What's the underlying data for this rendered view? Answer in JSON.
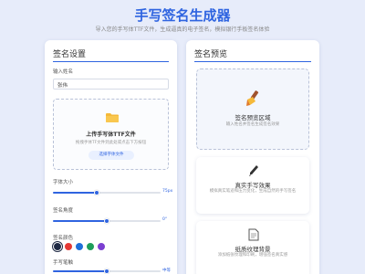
{
  "header": {
    "title": "手写签名生成器",
    "subtitle": "导入您的手写体TTF文件，生成逼真的电子签名，模拟银行手板签名体验"
  },
  "settings": {
    "title": "签名设置",
    "name_label": "输入姓名",
    "name_value": "张伟",
    "upload": {
      "title": "上传手写体TTF文件",
      "hint": "拖拽手体TF文件到此处或点击下方按钮",
      "button": "选择字体文件"
    },
    "font_size": {
      "label": "字体大小",
      "value_text": "75px",
      "fraction": 0.41
    },
    "signature_angle": {
      "label": "签名角度",
      "value_text": "0°",
      "fraction": 0.5
    },
    "signature_color": {
      "label": "签名颜色",
      "colors": [
        "#1f2a44",
        "#e53935",
        "#1e6fd9",
        "#1e9e5a",
        "#7b3fd1"
      ],
      "selected_index": 0
    },
    "stroke_thickness": {
      "label": "手写笔触",
      "value_text": "中等",
      "fraction": 0.5
    }
  },
  "preview": {
    "title": "签名预览",
    "area_title": "签名预览区域",
    "area_hint": "输入姓名并签名生成签名效果",
    "features": [
      {
        "icon": "pen-icon",
        "title": "真实手写效果",
        "desc": "模拟真实笔迹和压力变化，生成自然的手写签名"
      },
      {
        "icon": "paper-icon",
        "title": "纸质纹理背景",
        "desc": "添加纸张纹理和印刷，增强签名真实感"
      }
    ]
  },
  "colors": {
    "accent": "#2f64e0",
    "background": "#e7ecfa"
  }
}
